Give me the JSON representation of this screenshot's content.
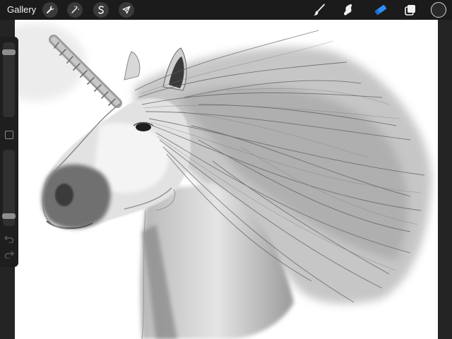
{
  "app": {
    "gallery_label": "Gallery"
  },
  "toolbar_left": [
    {
      "name": "actions",
      "icon": "wrench-icon"
    },
    {
      "name": "adjustments",
      "icon": "magic-wand-icon"
    },
    {
      "name": "selection",
      "icon": "selection-s-icon"
    },
    {
      "name": "transform",
      "icon": "arrow-cursor-icon"
    }
  ],
  "toolbar_right": [
    {
      "name": "brush",
      "icon": "brush-icon",
      "active": false
    },
    {
      "name": "smudge",
      "icon": "smudge-icon",
      "active": false
    },
    {
      "name": "eraser",
      "icon": "eraser-icon",
      "active": true
    },
    {
      "name": "layers",
      "icon": "layers-icon",
      "active": false
    }
  ],
  "colors": {
    "active_tool": "#2f8cf6",
    "toolbar_bg": "#1b1b1b",
    "background": "#242424",
    "canvas_bg": "#ffffff"
  },
  "sidebar": {
    "brush_size_level": 0.9,
    "opacity_level": 0.1
  }
}
